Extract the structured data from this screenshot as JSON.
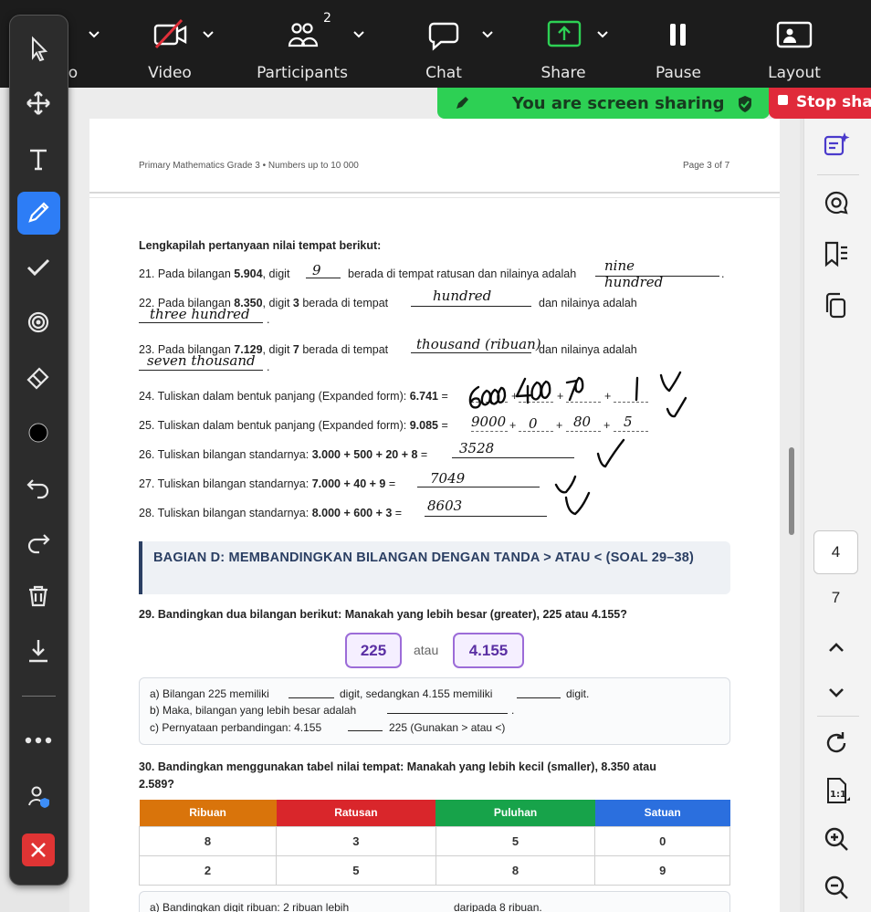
{
  "zoom_toolbar": {
    "participants_count": "2",
    "items": [
      {
        "label": "o"
      },
      {
        "label": "Video"
      },
      {
        "label": "Participants"
      },
      {
        "label": "Chat"
      },
      {
        "label": "Share"
      },
      {
        "label": "Pause"
      },
      {
        "label": "Layout"
      }
    ]
  },
  "share_banner": {
    "text": "You are screen sharing",
    "stop_label": "Stop share",
    "color": "#2dd054"
  },
  "document": {
    "header_left": "Primary Mathematics Grade 3 • Numbers up to 10 000",
    "header_right": "Page 3 of 7",
    "instruction": "Lengkapilah pertanyaan nilai tempat berikut:",
    "q21": {
      "a": "21. Pada bilangan ",
      "num": "5.904",
      "b": ", digit",
      "c": "berada di tempat ratusan dan nilainya adalah",
      "dot": ".",
      "ans_digit": "9",
      "ans_value_1": "nine",
      "ans_value_2": "hundred"
    },
    "q22": {
      "a": "22. Pada bilangan ",
      "num": "8.350",
      "b": ", digit ",
      "digit": "3",
      "c": " berada di tempat",
      "d": "dan nilainya adalah",
      "dot": ".",
      "ans_place": "hundred",
      "ans_value": "three  hundred"
    },
    "q23": {
      "a": "23. Pada bilangan ",
      "num": "7.129",
      "b": ", digit ",
      "digit": "7",
      "c": " berada di tempat",
      "d": "dan nilainya adalah",
      "dot": ".",
      "ans_place": "thousand (ribuan)",
      "ans_value": "seven thousand"
    },
    "q24": {
      "a": "24. Tuliskan dalam bentuk panjang (Expanded form): ",
      "num": "6.741",
      "eq": " =",
      "ans": [
        "6000",
        "400",
        "70",
        "1"
      ]
    },
    "q25": {
      "a": "25. Tuliskan dalam bentuk panjang (Expanded form): ",
      "num": "9.085",
      "eq": " =",
      "ans": [
        "9000",
        "0",
        "80",
        "5"
      ]
    },
    "q26": {
      "a": "26. Tuliskan bilangan standarnya: ",
      "expr": "3.000 + 500 + 20 + 8",
      "eq": " =",
      "ans": "3528"
    },
    "q27": {
      "a": "27. Tuliskan bilangan standarnya: ",
      "expr": "7.000 + 40 + 9",
      "eq": " =",
      "ans": "7049"
    },
    "q28": {
      "a": "28. Tuliskan bilangan standarnya: ",
      "expr": "8.000 + 600 + 3",
      "eq": " =",
      "ans": "8603"
    },
    "plus": "+",
    "part_d": "BAGIAN D: MEMBANDINGKAN BILANGAN DENGAN TANDA > ATAU < (SOAL 29–38)",
    "q29": {
      "text": "29. Bandingkan dua bilangan berikut: Manakah yang lebih besar (greater), 225 atau 4.155?",
      "box_a": "225",
      "or": "atau",
      "box_b": "4.155",
      "sub_a1": "a) Bilangan 225 memiliki",
      "sub_a2": "digit, sedangkan 4.155 memiliki",
      "sub_a3": "digit.",
      "sub_b": "b) Maka, bilangan yang lebih besar adalah",
      "sub_b_end": ".",
      "sub_c1": "c) Pernyataan perbandingan: 4.155",
      "sub_c2": "225 (Gunakan > atau <)"
    },
    "q30": {
      "text_1": "30. Bandingkan menggunakan tabel nilai tempat: Manakah yang lebih kecil (smaller), 8.350 atau",
      "text_2": "2.589?",
      "headers": [
        "Ribuan",
        "Ratusan",
        "Puluhan",
        "Satuan"
      ],
      "header_colors": [
        "#d9740b",
        "#d9262b",
        "#17a34a",
        "#2b6fde"
      ],
      "rows": [
        [
          "8",
          "3",
          "5",
          "0"
        ],
        [
          "2",
          "5",
          "8",
          "9"
        ]
      ],
      "sub_a1": "a) Bandingkan digit ribuan: 2 ribuan lebih",
      "sub_a2": "daripada 8 ribuan."
    }
  },
  "right_panel": {
    "current_page": "4",
    "total_pages": "7",
    "icons": [
      "ai-sparkle-icon",
      "comment-icon",
      "bookmarks-icon",
      "copy-icon",
      "chevron-up-icon",
      "chevron-down-icon",
      "refresh-icon",
      "actual-size-icon",
      "zoom-in-icon",
      "zoom-out-icon"
    ]
  },
  "annotation_toolbar": {
    "tools": [
      "select",
      "move",
      "text",
      "draw",
      "stamp",
      "spotlight",
      "eraser",
      "format",
      "undo",
      "redo",
      "clear",
      "save",
      "more",
      "request-control",
      "close"
    ],
    "active_tool": "draw",
    "active_color": "#2d7df6",
    "close_color": "#e03434"
  }
}
